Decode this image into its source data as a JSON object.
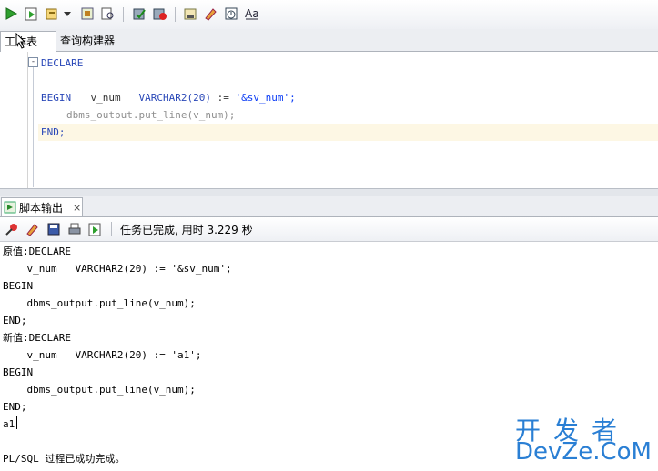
{
  "editor_tabs": {
    "worksheet": "工作表",
    "query_builder": "查询构建器"
  },
  "editor": {
    "line1": "DECLARE",
    "line2_var": "v_num",
    "line2_type": "VARCHAR2(20)",
    "line2_op": ":=",
    "line2_str": "'&sv_num';",
    "line3": "BEGIN",
    "line4": "dbms_output.put_line(v_num);",
    "line5": "END;",
    "fold_marker": "-"
  },
  "output_tab": {
    "label": "脚本输出",
    "close": "×"
  },
  "status_text": "任务已完成, 用时 3.229 秒",
  "output_lines": [
    "原值:DECLARE",
    "    v_num   VARCHAR2(20) := '&sv_num';",
    "BEGIN",
    "    dbms_output.put_line(v_num);",
    "END;",
    "新值:DECLARE",
    "    v_num   VARCHAR2(20) := 'a1';",
    "BEGIN",
    "    dbms_output.put_line(v_num);",
    "END;",
    "a1",
    "",
    "PL/SQL 过程已成功完成。"
  ],
  "watermark": {
    "top": "开发者",
    "bottom": "DevZe.CoM"
  },
  "toolbar_icons": [
    "run-icon",
    "run-script-icon",
    "explain-plan-icon",
    "dropdown-icon",
    "autotrace-icon",
    "sql-tuning-icon",
    "commit-icon",
    "rollback-icon",
    "sql-history-icon",
    "clear-icon",
    "timer-icon",
    "format-case-icon"
  ],
  "colors": {
    "keyword": "#2a48b8",
    "string": "#0c3df5",
    "current_line": "#fdf7e4",
    "watermark": "#2a7fd4"
  }
}
